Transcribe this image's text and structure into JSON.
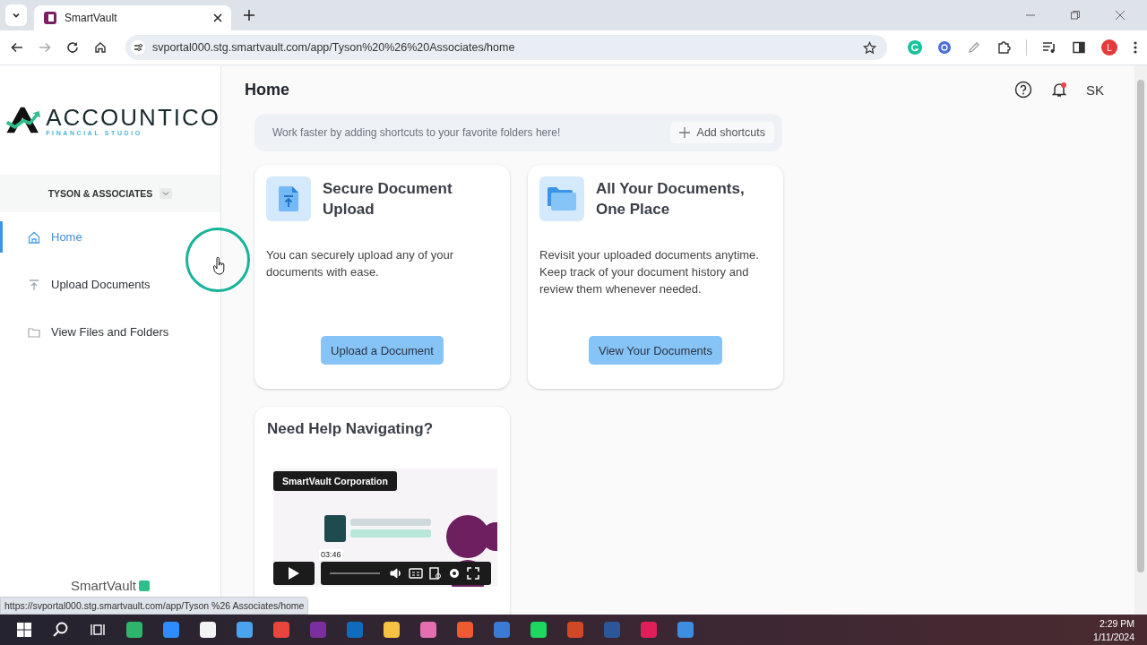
{
  "browser": {
    "tabs": [
      {
        "title": "SmartVault",
        "selected": true
      }
    ],
    "url": "svportal000.stg.smartvault.com/app/Tyson%20%26%20Associates/home",
    "profile": "L",
    "status_url": "https://svportal000.stg.smartvault.com/app/Tyson %26 Associates/home"
  },
  "sidebar": {
    "logo": {
      "name": "ACCOUNTICO",
      "tagline": "FINANCIAL STUDIO"
    },
    "org": "TYSON & ASSOCIATES",
    "nav": [
      {
        "label": "Home",
        "kind": "home",
        "selected": true
      },
      {
        "label": "Upload Documents",
        "kind": "upload",
        "selected": false
      },
      {
        "label": "View Files and Folders",
        "kind": "folder",
        "selected": false
      }
    ],
    "footer": "SmartVault"
  },
  "header": {
    "title": "Home",
    "user": "SK",
    "notification": true
  },
  "shortcuts": {
    "text": "Work faster by adding shortcuts to your favorite folders here!",
    "button": "Add shortcuts"
  },
  "cards": [
    {
      "kind": "upload",
      "title": "Secure Document Upload",
      "body": "You can securely upload any of your documents with ease.",
      "button": "Upload a Document"
    },
    {
      "kind": "folder",
      "title": "All Your Documents, One Place",
      "body": "Revisit your uploaded documents anytime. Keep track of your document history and review them whenever needed.",
      "button": "View Your Documents"
    }
  ],
  "help": {
    "title": "Need Help Navigating?",
    "video": {
      "channel": "SmartVault Corporation",
      "duration": "03:46"
    }
  },
  "taskbar": {
    "apps": [
      {
        "kind": "windows"
      },
      {
        "kind": "search"
      },
      {
        "kind": "taskview"
      },
      {
        "kind": "edge"
      },
      {
        "kind": "zoom"
      },
      {
        "kind": "store"
      },
      {
        "kind": "mail"
      },
      {
        "kind": "chrome"
      },
      {
        "kind": "onenote"
      },
      {
        "kind": "outlook"
      },
      {
        "kind": "files"
      },
      {
        "kind": "photos"
      },
      {
        "kind": "slides"
      },
      {
        "kind": "docs"
      },
      {
        "kind": "music"
      },
      {
        "kind": "powerpoint"
      },
      {
        "kind": "word"
      },
      {
        "kind": "slack"
      },
      {
        "kind": "vault"
      }
    ],
    "time": "2:29 PM",
    "date": "1/11/2024"
  }
}
